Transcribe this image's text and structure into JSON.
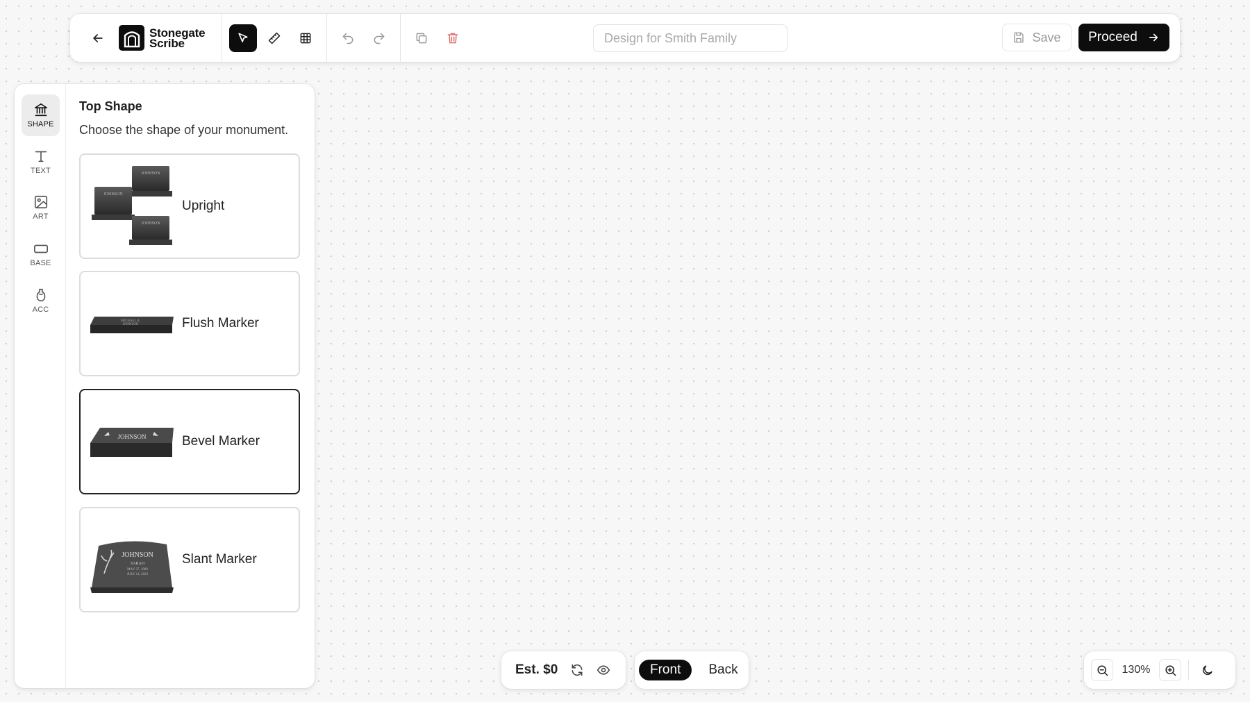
{
  "app": {
    "name": "Stonegate Scribe",
    "name_line1": "Stonegate",
    "name_line2": "Scribe"
  },
  "toolbar": {
    "back_icon": "arrow-left-icon",
    "tools": [
      "cursor-icon",
      "ruler-icon",
      "grid-icon"
    ],
    "active_tool": "cursor-icon",
    "history": [
      "undo-icon",
      "redo-icon"
    ],
    "edit": [
      "duplicate-icon",
      "trash-icon"
    ],
    "design_name_placeholder": "Design for Smith Family",
    "design_name_value": "",
    "save_label": "Save",
    "proceed_label": "Proceed"
  },
  "rail": {
    "items": [
      {
        "label": "SHAPE",
        "icon": "monument-icon",
        "active": true
      },
      {
        "label": "TEXT",
        "icon": "text-icon",
        "active": false
      },
      {
        "label": "ART",
        "icon": "image-icon",
        "active": false
      },
      {
        "label": "BASE",
        "icon": "base-icon",
        "active": false
      },
      {
        "label": "ACC",
        "icon": "vase-icon",
        "active": false
      }
    ]
  },
  "panel": {
    "title": "Top Shape",
    "subtitle": "Choose the shape of your monument.",
    "shapes": [
      {
        "label": "Upright",
        "selected": false
      },
      {
        "label": "Flush Marker",
        "selected": false
      },
      {
        "label": "Bevel Marker",
        "selected": true
      },
      {
        "label": "Slant Marker",
        "selected": false
      }
    ],
    "thumb_engravings": {
      "upright": "JOHNSON",
      "flush_line1": "MICHAEL A.",
      "flush_line2": "JOHNSON",
      "bevel": "JOHNSON",
      "slant_name": "JOHNSON",
      "slant_first": "SARAH",
      "slant_date1": "MAY 27, 1980",
      "slant_date2": "JULY 14, 2023"
    }
  },
  "bottom": {
    "estimate": "Est. $0",
    "sides": [
      "Front",
      "Back"
    ],
    "active_side": "Front",
    "zoom": "130%"
  },
  "colors": {
    "accent": "#0d0d0d",
    "danger": "#e07070",
    "canvas": "#f7f7f7"
  }
}
